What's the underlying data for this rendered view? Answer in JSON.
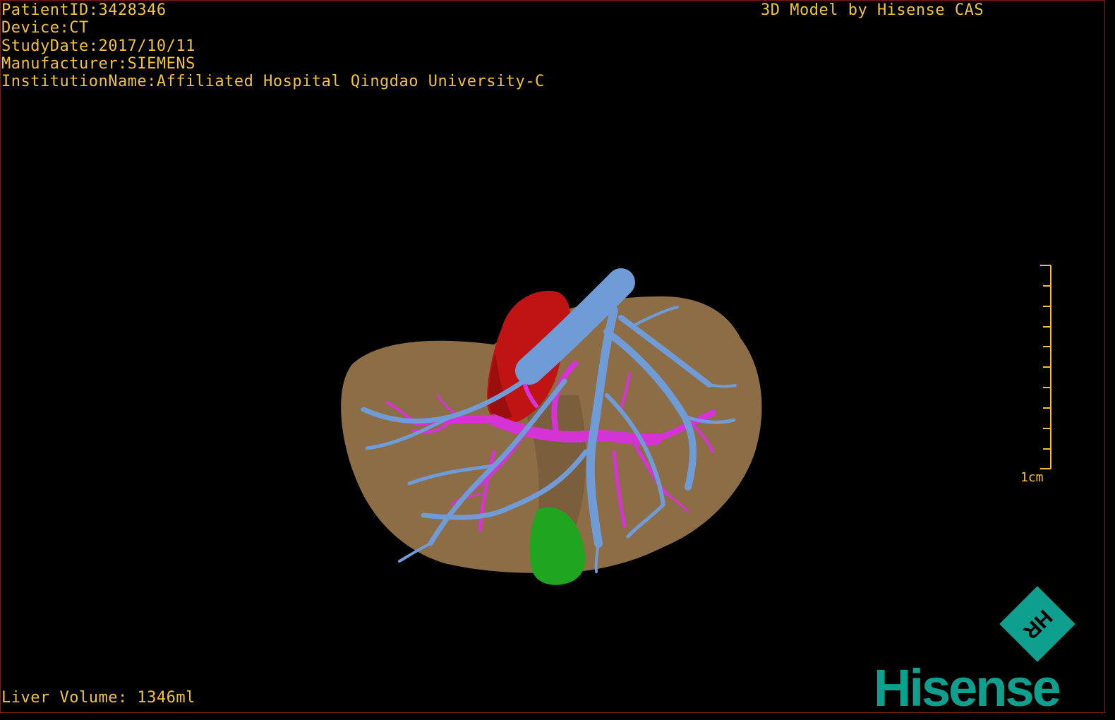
{
  "overlay": {
    "patient_id": "PatientID:3428346",
    "device": "Device:CT",
    "study_date": "StudyDate:2017/10/11",
    "manufacturer": "Manufacturer:SIEMENS",
    "institution": "InstitutionName:Affiliated Hospital Qingdao University-C",
    "credit": "3D Model by Hisense CAS",
    "liver_volume": "Liver Volume: 1346ml"
  },
  "scale_bar": {
    "label": "1cm"
  },
  "logo": {
    "brand": "Hisense",
    "badge_text": "HR"
  },
  "colors": {
    "text": "#f1c232",
    "liver": "#8c6d45",
    "vein": "#6f9bd6",
    "portal": "#d633d6",
    "artery": "#c01313",
    "gallbladder": "#1fa51f",
    "brand": "#0e9f8f"
  }
}
